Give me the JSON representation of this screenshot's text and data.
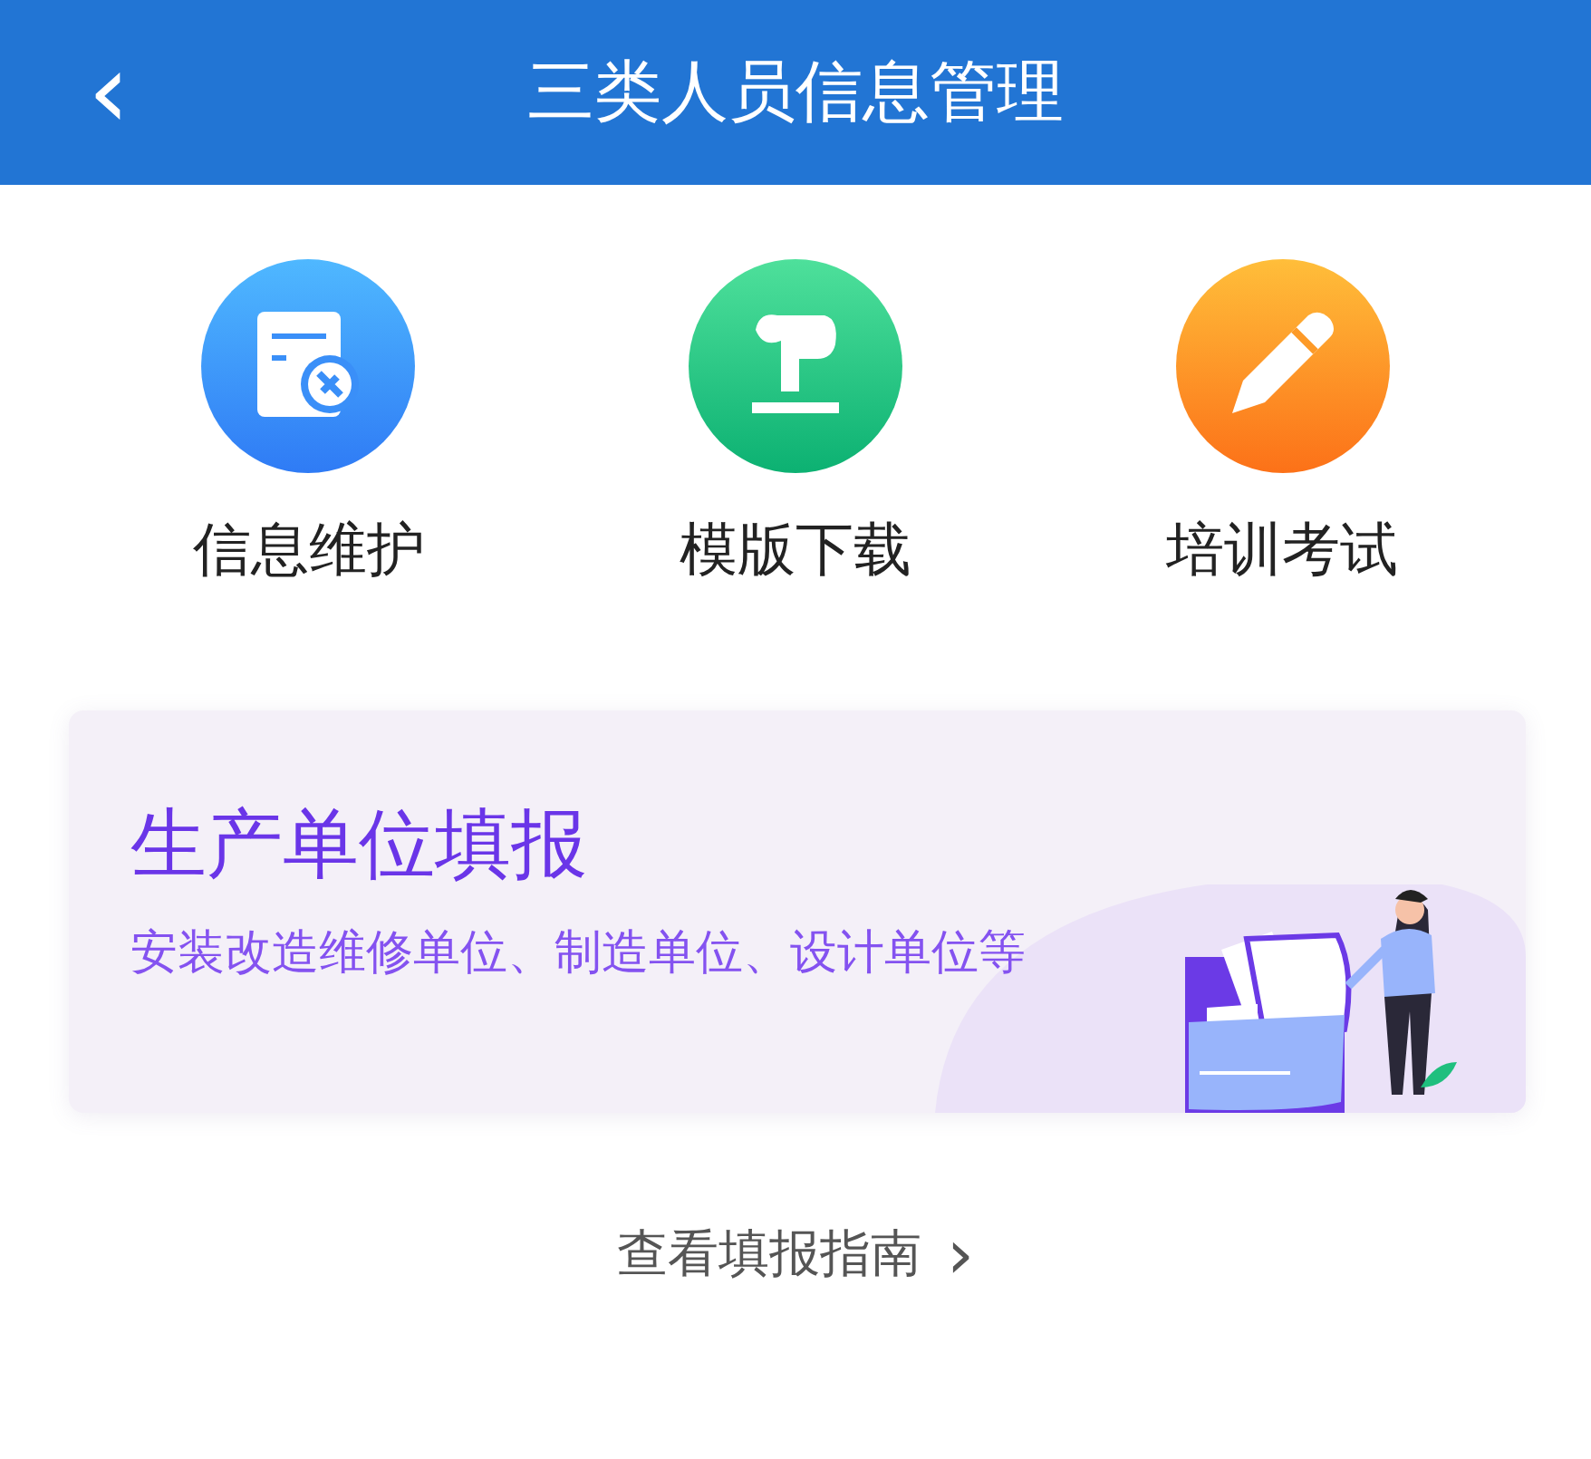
{
  "header": {
    "back_icon": "‹",
    "title": "三类人员信息管理"
  },
  "shortcuts": [
    {
      "label": "信息维护",
      "kind": "form"
    },
    {
      "label": "模版下载",
      "kind": "download"
    },
    {
      "label": "培训考试",
      "kind": "exam"
    }
  ],
  "banner": {
    "title": "生产单位填报",
    "subtitle": "安装改造维修单位、制造单位、设计单位等"
  },
  "guide_link": {
    "label": "查看填报指南",
    "chevron": "›"
  }
}
